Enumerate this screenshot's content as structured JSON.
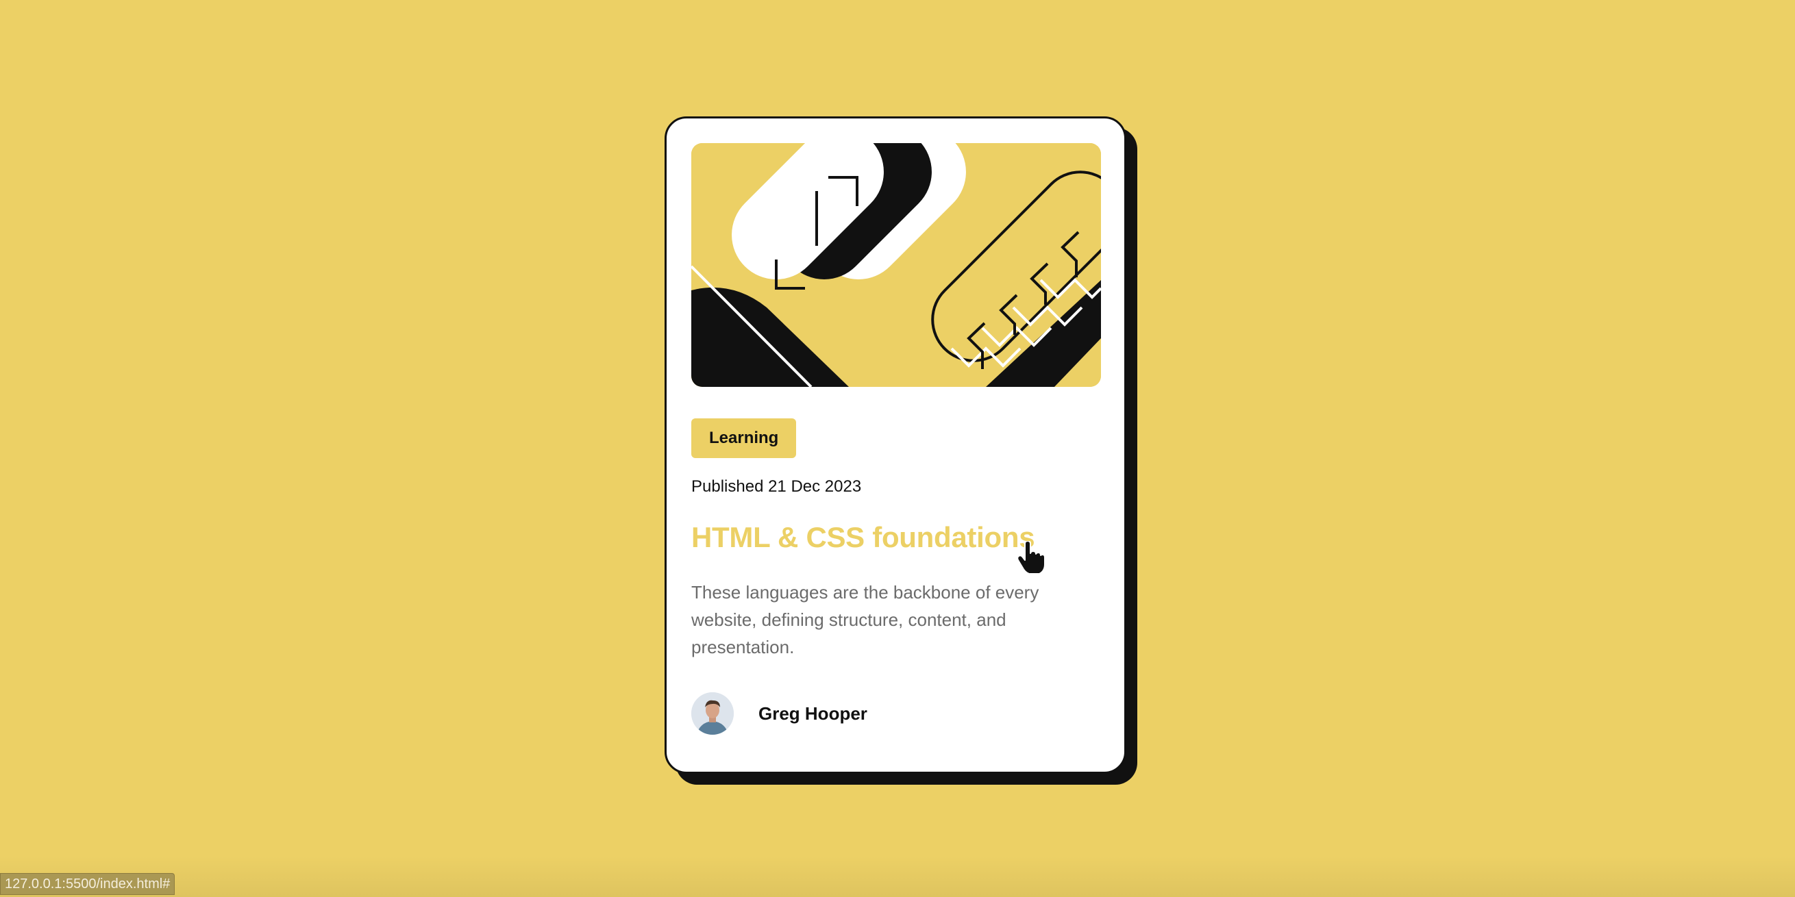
{
  "card": {
    "tag": "Learning",
    "published": "Published 21 Dec 2023",
    "title": "HTML & CSS foundations",
    "description": "These languages are the backbone of every website, defining structure, content, and presentation.",
    "author": {
      "name": "Greg Hooper",
      "avatar_icon": "person-avatar-icon"
    },
    "illustration_icon": "abstract-illustration-icon"
  },
  "status_bar": {
    "url": "127.0.0.1:5500/index.html#"
  },
  "cursor_icon": "hand-pointer-icon",
  "colors": {
    "background": "#ecd065",
    "card": "#ffffff",
    "ink": "#111111",
    "accent": "#ecd065",
    "muted_text": "#6b6b6b"
  }
}
